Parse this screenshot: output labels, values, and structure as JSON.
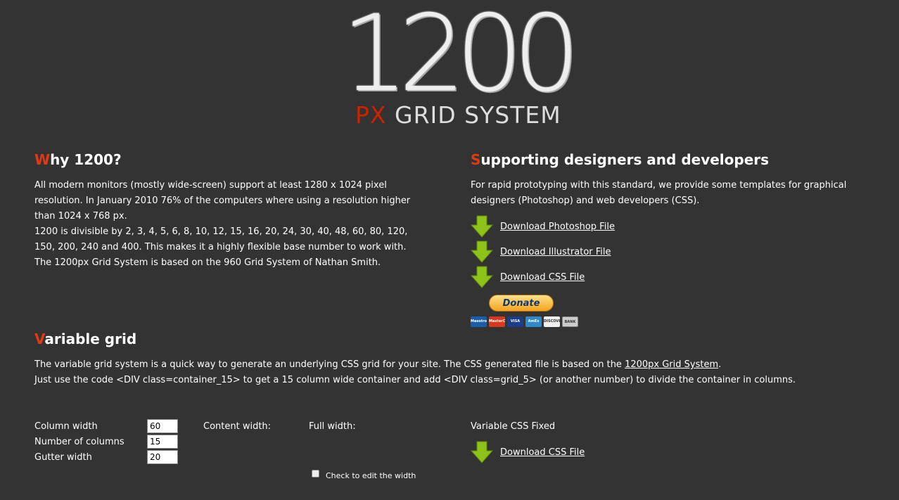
{
  "logo": {
    "number": "1200",
    "px": "PX",
    "rest": "GRID SYSTEM"
  },
  "why": {
    "first": "W",
    "rest": "hy 1200?",
    "lines": [
      "All modern monitors (mostly wide-screen) support at least 1280 x 1024 pixel",
      "resolution. In January 2010 76% of the computers where using a resolution higher",
      "than 1024 x 768 px.",
      "1200 is divisible by 2, 3, 4, 5, 6, 8, 10, 12, 15, 16, 20, 24, 30, 40, 48, 60, 80, 120,",
      "150, 200, 240 and 400. This makes it a highly flexible base number to work with.",
      "The 1200px Grid System is based on the 960 Grid System of Nathan Smith."
    ]
  },
  "support": {
    "first": "S",
    "rest": "upporting designers and developers",
    "lines": [
      "For rapid prototyping with this standard, we provide some templates for graphical",
      "designers (Photoshop) and web developers (CSS)."
    ],
    "downloads": [
      "Download Photoshop File",
      "Download Illustrator File",
      "Download CSS File"
    ],
    "donate": "Donate",
    "cards": [
      "Maestro",
      "MasterCard",
      "VISA",
      "AmEx",
      "DISCOVER",
      "BANK"
    ]
  },
  "variable": {
    "first": "V",
    "rest": "ariable grid",
    "line1_pre": "The variable grid system is a quick way to generate an underlying CSS grid for your site. The CSS generated file is based on the ",
    "line1_link": "1200px Grid System",
    "line1_post": ".",
    "line2": "Just use the code <DIV class=container_15> to get a 15 column wide container and add <DIV class=grid_5> (or another number) to divide the container in columns."
  },
  "form": {
    "column_width_label": "Column width",
    "column_width": "60",
    "num_columns_label": "Number of columns",
    "num_columns": "15",
    "gutter_label": "Gutter width",
    "gutter": "20",
    "content_width_label": "Content width:",
    "full_width_label": "Full width:",
    "check_label": "Check to edit the width",
    "css_fixed_label": "Variable CSS Fixed",
    "download_css": "Download CSS File"
  },
  "colors": {
    "background": "#333333",
    "accent": "#e03a14",
    "arrow": "#8dc219"
  }
}
